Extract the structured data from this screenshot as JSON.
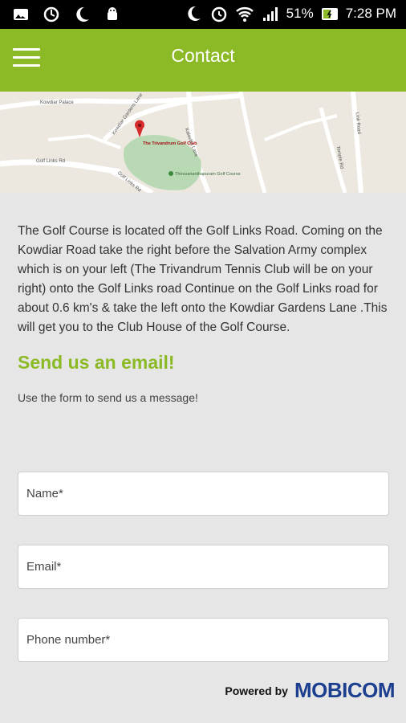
{
  "status_bar": {
    "battery": "51%",
    "time": "7:28 PM",
    "icons": [
      "image-icon",
      "sync-icon",
      "moon-icon",
      "android-icon",
      "moon-icon",
      "alarm-icon",
      "wifi-icon",
      "signal-icon",
      "battery-icon"
    ]
  },
  "header": {
    "title": "Contact",
    "menu_icon": "menu-icon"
  },
  "map": {
    "labels": {
      "palace": "Kowdiar Palace",
      "kowdiar_gardens": "Kowdiar Gardens Lane",
      "kalavilla": "Kalavilla Lane",
      "golf_links_rd": "Golf Links Rd",
      "golf_links_rd2": "Golf Links Rd",
      "club": "The Trivandrum Golf Club",
      "course": "Thiruvananthapuram Golf Course",
      "temple_rd": "Temple Rd",
      "link_road": "Link Road"
    }
  },
  "content": {
    "description": "The Golf Course is located off the Golf Links Road. Coming on the Kowdiar Road take the right before the Salvation Army complex which is on your left (The Trivandrum Tennis Club will be on your right) onto the Golf Links road Continue on the Golf Links road for about 0.6 km's & take the left onto the Kowdiar Gardens Lane .This will get you to the Club House of the Golf Course.",
    "heading": "Send us an email!",
    "subtext": "Use the form to send us a message!"
  },
  "form": {
    "name_placeholder": "Name*",
    "email_placeholder": "Email*",
    "phone_placeholder": "Phone number*"
  },
  "footer": {
    "powered_by": "Powered by",
    "brand": "MOBICOM"
  },
  "colors": {
    "accent": "#8cba26",
    "brand": "#1d3f8f"
  }
}
